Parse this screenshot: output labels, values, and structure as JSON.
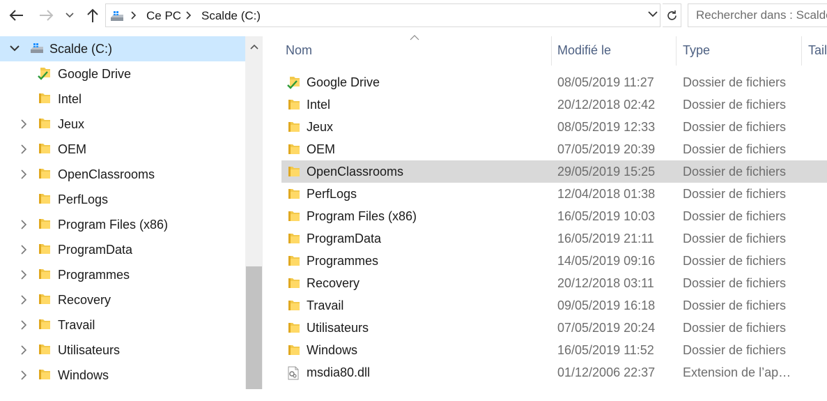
{
  "colors": {
    "selection_bg": "#cce8ff",
    "hover_bg": "#d9d9d9",
    "folder_yellow": "#f3c94b",
    "header_text": "#4d6082",
    "secondary_text": "#6d6d6d"
  },
  "addressbar": {
    "breadcrumbs": [
      "Ce PC",
      "Scalde (C:)"
    ],
    "search_placeholder": "Rechercher dans : Scalde (C:)"
  },
  "navpane": {
    "items": [
      {
        "label": "Scalde (C:)",
        "icon": "drive-icon",
        "expanded": true,
        "selected": true
      },
      {
        "label": "Google Drive",
        "icon": "google-drive-folder-icon",
        "has_children": false
      },
      {
        "label": "Intel",
        "icon": "folder-icon",
        "has_children": false
      },
      {
        "label": "Jeux",
        "icon": "folder-icon",
        "has_children": true
      },
      {
        "label": "OEM",
        "icon": "folder-icon",
        "has_children": true
      },
      {
        "label": "OpenClassrooms",
        "icon": "folder-icon",
        "has_children": true
      },
      {
        "label": "PerfLogs",
        "icon": "folder-icon",
        "has_children": false
      },
      {
        "label": "Program Files (x86)",
        "icon": "folder-icon",
        "has_children": true
      },
      {
        "label": "ProgramData",
        "icon": "folder-icon",
        "has_children": true
      },
      {
        "label": "Programmes",
        "icon": "folder-icon",
        "has_children": true
      },
      {
        "label": "Recovery",
        "icon": "folder-icon",
        "has_children": true
      },
      {
        "label": "Travail",
        "icon": "folder-icon",
        "has_children": true
      },
      {
        "label": "Utilisateurs",
        "icon": "folder-icon",
        "has_children": true
      },
      {
        "label": "Windows",
        "icon": "folder-icon",
        "has_children": true
      }
    ]
  },
  "filelist": {
    "columns": [
      "Nom",
      "Modifié le",
      "Type",
      "Taille"
    ],
    "rows": [
      {
        "name": "Google Drive",
        "date": "08/05/2019 11:27",
        "type": "Dossier de fichiers",
        "icon": "google-drive-folder-icon"
      },
      {
        "name": "Intel",
        "date": "20/12/2018 02:42",
        "type": "Dossier de fichiers",
        "icon": "folder-icon"
      },
      {
        "name": "Jeux",
        "date": "08/05/2019 12:33",
        "type": "Dossier de fichiers",
        "icon": "folder-icon"
      },
      {
        "name": "OEM",
        "date": "07/05/2019 20:39",
        "type": "Dossier de fichiers",
        "icon": "folder-icon"
      },
      {
        "name": "OpenClassrooms",
        "date": "29/05/2019 15:25",
        "type": "Dossier de fichiers",
        "icon": "folder-icon",
        "hovered": true
      },
      {
        "name": "PerfLogs",
        "date": "12/04/2018 01:38",
        "type": "Dossier de fichiers",
        "icon": "folder-icon"
      },
      {
        "name": "Program Files (x86)",
        "date": "16/05/2019 10:03",
        "type": "Dossier de fichiers",
        "icon": "folder-icon"
      },
      {
        "name": "ProgramData",
        "date": "16/05/2019 21:11",
        "type": "Dossier de fichiers",
        "icon": "folder-icon"
      },
      {
        "name": "Programmes",
        "date": "14/05/2019 09:16",
        "type": "Dossier de fichiers",
        "icon": "folder-icon"
      },
      {
        "name": "Recovery",
        "date": "20/12/2018 03:11",
        "type": "Dossier de fichiers",
        "icon": "folder-icon"
      },
      {
        "name": "Travail",
        "date": "09/05/2019 16:18",
        "type": "Dossier de fichiers",
        "icon": "folder-icon"
      },
      {
        "name": "Utilisateurs",
        "date": "07/05/2019 20:24",
        "type": "Dossier de fichiers",
        "icon": "folder-icon"
      },
      {
        "name": "Windows",
        "date": "16/05/2019 11:52",
        "type": "Dossier de fichiers",
        "icon": "folder-icon"
      },
      {
        "name": "msdia80.dll",
        "date": "01/12/2006 22:37",
        "type": "Extension de l’application",
        "icon": "dll-file-icon"
      }
    ]
  }
}
